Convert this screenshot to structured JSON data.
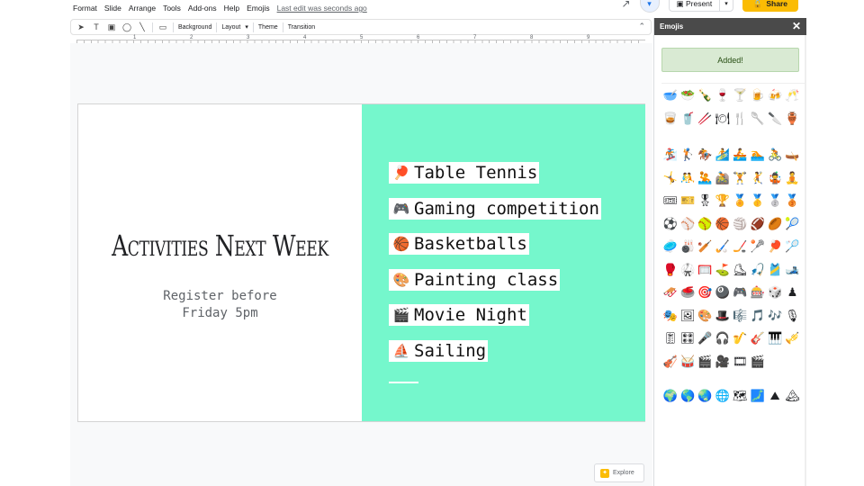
{
  "menu": [
    "Format",
    "Slide",
    "Arrange",
    "Tools",
    "Add-ons",
    "Help",
    "Emojis"
  ],
  "last_edit": "Last edit was seconds ago",
  "header": {
    "present_label": "Present",
    "share_label": "Share"
  },
  "toolbar": {
    "background": "Background",
    "layout": "Layout",
    "theme": "Theme",
    "transition": "Transition"
  },
  "ruler_numbers": [
    "1",
    "2",
    "3",
    "4",
    "5",
    "6",
    "7",
    "8",
    "9"
  ],
  "slide": {
    "title": "Activities Next Week",
    "subtitle_line1": "Register before",
    "subtitle_line2": "Friday 5pm",
    "accent_color": "#75f7cc",
    "activities": [
      {
        "emoji": "🏓",
        "label": "Table Tennis"
      },
      {
        "emoji": "🎮",
        "label": "Gaming competition"
      },
      {
        "emoji": "🏀",
        "label": "Basketballs"
      },
      {
        "emoji": "🎨",
        "label": "Painting class"
      },
      {
        "emoji": "🎬",
        "label": "Movie Night"
      },
      {
        "emoji": "⛵",
        "label": "Sailing"
      }
    ]
  },
  "explore_label": "Explore",
  "sidebar": {
    "title": "Emojis",
    "close_icon": "close-icon",
    "added_label": "Added!",
    "emoji_groups": [
      [
        "🥣",
        "🥗",
        "🍾",
        "🍷",
        "🍸",
        "🍺",
        "🍻",
        "🥂",
        "🥃",
        "🥤",
        "🥢",
        "🍽",
        "🍴",
        "🥄",
        "🔪",
        "🏺"
      ],
      [
        "🏂",
        "🏌",
        "🏇",
        "🏄",
        "🚣",
        "🏊",
        "🚴",
        "🛶",
        "🤸",
        "🤼",
        "🤽",
        "🚵",
        "🏋",
        "🤾",
        "🤹",
        "🧘",
        "🎟",
        "🎫",
        "🎖",
        "🏆",
        "🏅",
        "🥇",
        "🥈",
        "🥉",
        "⚽",
        "⚾",
        "🥎",
        "🏀",
        "🏐",
        "🏈",
        "🏉",
        "🎾",
        "🥏",
        "🎳",
        "🏏",
        "🏑",
        "🏒",
        "🥍",
        "🏓",
        "🏸",
        "🥊",
        "🥋",
        "🥅",
        "⛳",
        "⛸",
        "🎣",
        "🎽",
        "🎿",
        "🛷",
        "🥌",
        "🎯",
        "🎱",
        "🎮",
        "🎰",
        "🎲",
        "♟",
        "🎭",
        "🖼",
        "🎨",
        "🎩",
        "🎼",
        "🎵",
        "🎶",
        "🎙",
        "🎚",
        "🎛",
        "🎤",
        "🎧",
        "🎷",
        "🎸",
        "🎹",
        "🎺",
        "🎻",
        "🥁",
        "🎬",
        "🎥",
        "🎞",
        "🎬"
      ],
      [
        "🌍",
        "🌎",
        "🌏",
        "🌐",
        "🗺",
        "🗾",
        "⛰",
        "🏔"
      ]
    ]
  }
}
